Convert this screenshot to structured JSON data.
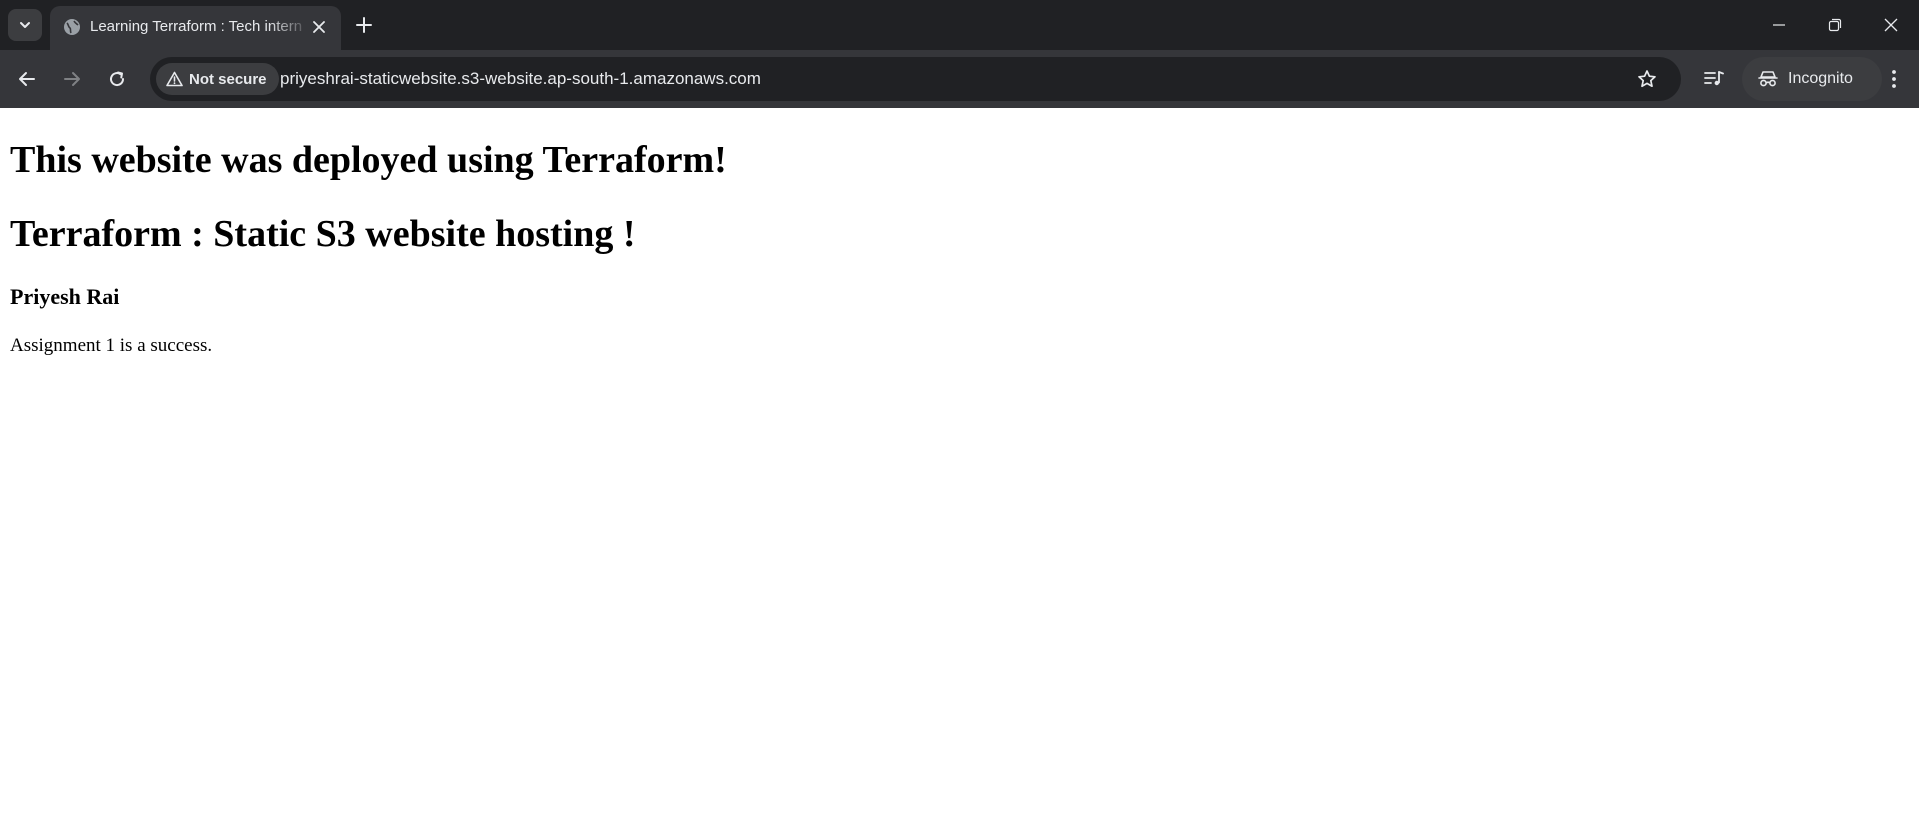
{
  "browser": {
    "tab": {
      "title": "Learning Terraform : Tech intern",
      "favicon": "globe-icon"
    },
    "address_bar": {
      "security_label": "Not secure",
      "url": "priyeshrai-staticwebsite.s3-website.ap-south-1.amazonaws.com"
    },
    "profile": {
      "label": "Incognito"
    },
    "colors": {
      "tabstrip_bg": "#202124",
      "toolbar_bg": "#35363a",
      "omnibox_bg": "#202124",
      "text": "#e8eaed"
    }
  },
  "page": {
    "heading_1": "This website was deployed using Terraform!",
    "heading_2": "Terraform : Static S3 website hosting !",
    "author": "Priyesh Rai",
    "message": "Assignment 1 is a success."
  }
}
